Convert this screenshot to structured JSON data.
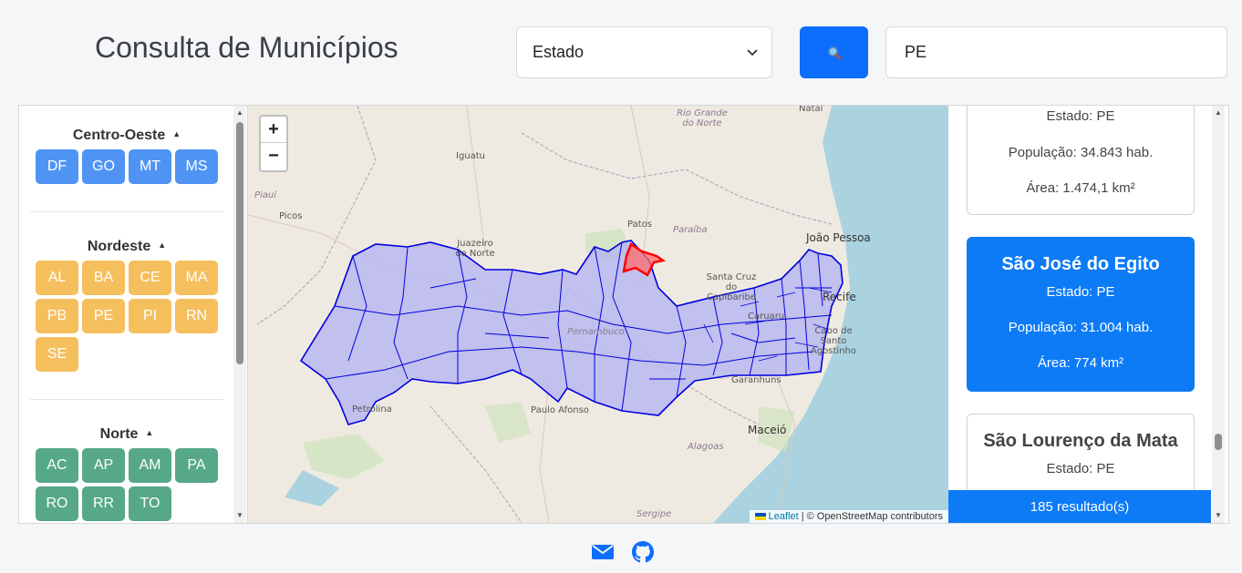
{
  "header": {
    "title": "Consulta de Municípios",
    "filter_select": "Estado",
    "search_icon": "magnifier-icon",
    "search_value": "PE"
  },
  "regions": [
    {
      "name": "Centro-Oeste",
      "states": [
        "DF",
        "GO",
        "MT",
        "MS"
      ],
      "color": "#4f94f5"
    },
    {
      "name": "Nordeste",
      "states": [
        "AL",
        "BA",
        "CE",
        "MA",
        "PB",
        "PE",
        "PI",
        "RN",
        "SE"
      ],
      "color": "#f5bf5e"
    },
    {
      "name": "Norte",
      "states": [
        "AC",
        "AP",
        "AM",
        "PA",
        "RO",
        "RR",
        "TO"
      ],
      "color": "#56a888"
    }
  ],
  "map": {
    "zoom_in": "+",
    "zoom_out": "−",
    "labels": {
      "natal": "Natal",
      "rio_grande_do_norte": "Rio Grande do Norte",
      "iguatu": "Iguatu",
      "piaui": "Piauí",
      "picos": "Picos",
      "patos": "Patos",
      "paraiba": "Paraíba",
      "joao_pessoa": "João Pessoa",
      "juazeiro": "Juazeiro do Norte",
      "santa_cruz": "Santa Cruz do Capibaribe",
      "recife": "Recife",
      "caruaru": "Caruaru",
      "cabo": "Cabo de Santo Agostinho",
      "pernambuco": "Pernambuco",
      "petrolina": "Petrolina",
      "paulo_afonso": "Paulo Afonso",
      "maceio": "Maceió",
      "alagoas": "Alagoas",
      "sergipe": "Sergipe",
      "garanhuns": "Garanhuns"
    },
    "attribution_leaflet": "Leaflet",
    "attribution_rest": " | © OpenStreetMap contributors",
    "highlight_color": "#ff0000",
    "region_fill": "#b8b8f0",
    "region_stroke": "#0000e0"
  },
  "results": {
    "cards": [
      {
        "name": "",
        "estado": "Estado: PE",
        "populacao": "População: 34.843 hab.",
        "area": "Área: 1.474,1 km²",
        "active": false
      },
      {
        "name": "São José do Egito",
        "estado": "Estado: PE",
        "populacao": "População: 31.004 hab.",
        "area": "Área: 774 km²",
        "active": true
      },
      {
        "name": "São Lourenço da Mata",
        "estado": "Estado: PE",
        "populacao": "",
        "area": "",
        "active": false
      }
    ],
    "count": "185 resultado(s)"
  },
  "footer": {
    "icons": [
      "mail-icon",
      "github-icon"
    ]
  }
}
